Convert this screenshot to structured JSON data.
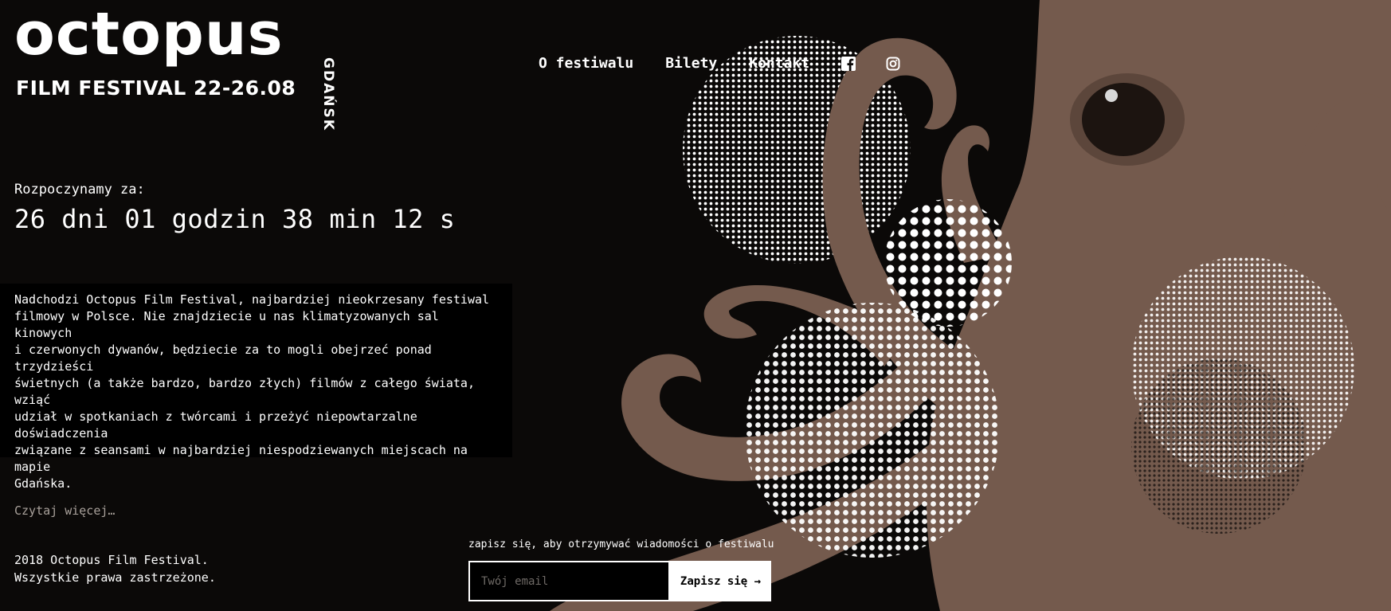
{
  "colors": {
    "background": "#0b0908",
    "octopus": "#745a4d",
    "text": "#ffffff",
    "muted": "#a9a19b"
  },
  "logo": {
    "name": "octopus",
    "subtitle": "FILM FESTIVAL 22-26.08",
    "city": "GDAŃSK"
  },
  "nav": {
    "items": [
      {
        "label": "O festiwalu"
      },
      {
        "label": "Bilety"
      },
      {
        "label": "Kontakt"
      }
    ],
    "icons": [
      "facebook-icon",
      "instagram-icon"
    ]
  },
  "countdown": {
    "label": "Rozpoczynamy za:",
    "value": "26 dni 01 godzin 38 min 12 s"
  },
  "about": {
    "text": "Nadchodzi Octopus Film Festival, najbardziej nieokrzesany festiwal\nfilmowy w Polsce. Nie znajdziecie u nas klimatyzowanych sal kinowych\ni czerwonych dywanów, będziecie za to mogli obejrzeć ponad trzydzieści\nświetnych (a także bardzo, bardzo złych) filmów z całego świata, wziąć\nudział w spotkaniach z twórcami i przeżyć niepowtarzalne doświadczenia\nzwiązane z seansami w najbardziej niespodziewanych miejscach na mapie\nGdańska.",
    "read_more": "Czytaj więcej…"
  },
  "footer": {
    "line1": "2018 Octopus Film Festival.",
    "line2": "Wszystkie prawa zastrzeżone."
  },
  "newsletter": {
    "label": "zapisz się, aby otrzymywać wiadomości o festiwalu",
    "placeholder": "Twój email",
    "button": "Zapisz się →"
  }
}
